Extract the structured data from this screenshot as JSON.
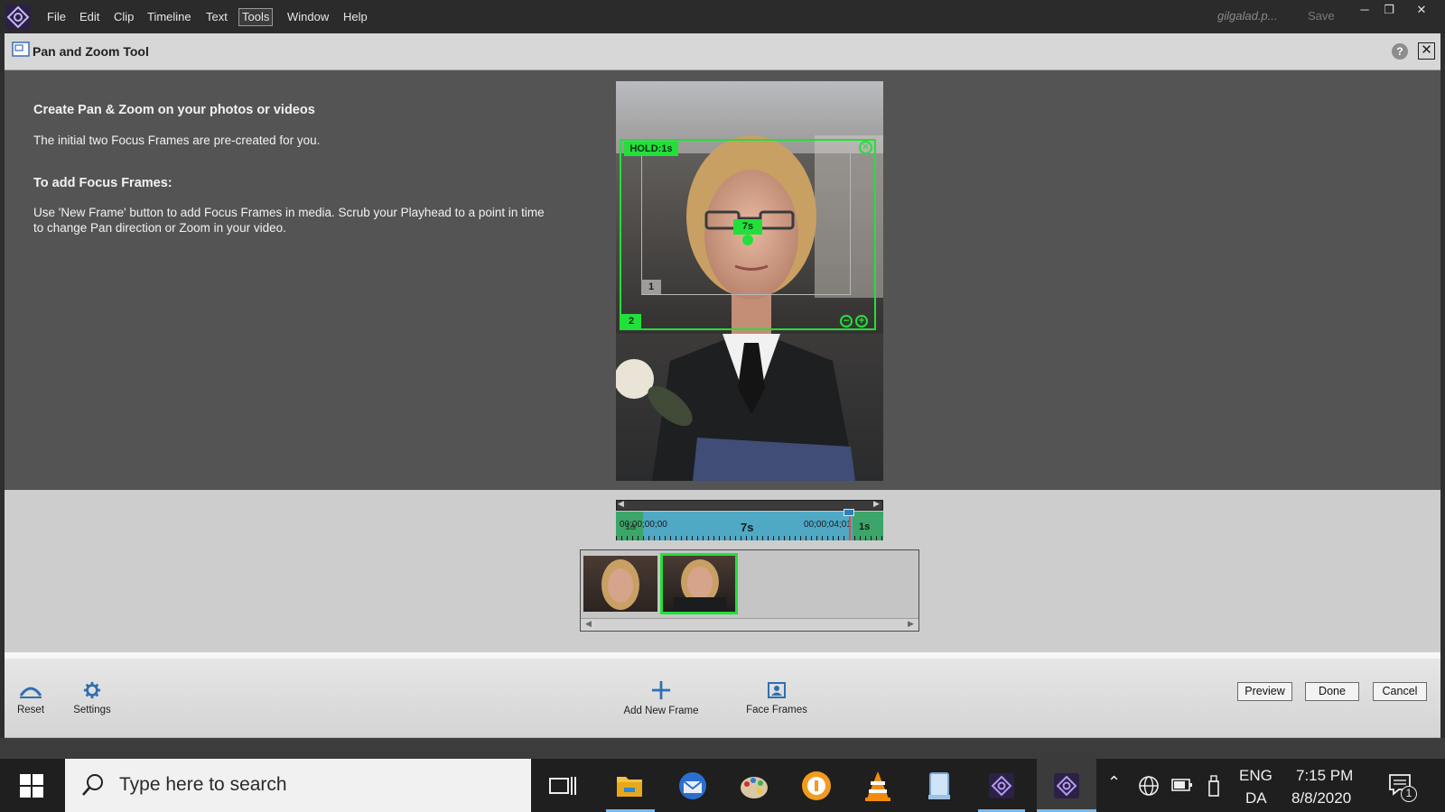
{
  "menubar": {
    "items": [
      "File",
      "Edit",
      "Clip",
      "Timeline",
      "Text",
      "Tools",
      "Window",
      "Help"
    ],
    "active_item": "Tools",
    "user": "gilgalad.p...",
    "save_label": "Save"
  },
  "dialog": {
    "title": "Pan and Zoom Tool",
    "help_label": "?",
    "close_label": "✕"
  },
  "instructions": {
    "heading1": "Create Pan & Zoom on your photos or videos",
    "line1": "The initial two Focus Frames are pre-created for you.",
    "heading2": "To add Focus Frames:",
    "line2a": "Use 'New Frame' button to add Focus Frames in media. Scrub your Playhead to a point in time",
    "line2b": "to change Pan direction or Zoom in your video."
  },
  "preview": {
    "hold_label": "HOLD:1s",
    "transition_label": "7s",
    "frame1_number": "1",
    "frame2_number": "2"
  },
  "timeline": {
    "start_timecode": "00;00;00;00",
    "start_hold": "1s",
    "middle_label": "7s",
    "end_timecode": "00;00;04;01",
    "end_hold": "1s"
  },
  "toolbar": {
    "reset_label": "Reset",
    "settings_label": "Settings",
    "add_frame_label": "Add New Frame",
    "face_frames_label": "Face Frames",
    "preview_label": "Preview",
    "done_label": "Done",
    "cancel_label": "Cancel"
  },
  "taskbar": {
    "search_placeholder": "Type here to search",
    "lang_top": "ENG",
    "lang_bottom": "DA",
    "time": "7:15 PM",
    "date": "8/8/2020",
    "notification_count": "1"
  },
  "colors": {
    "focus_green": "#22e03a",
    "timeline_blue": "#4fa8c4",
    "workarea_gray": "#545454",
    "accent_purple": "#7a58c9"
  }
}
